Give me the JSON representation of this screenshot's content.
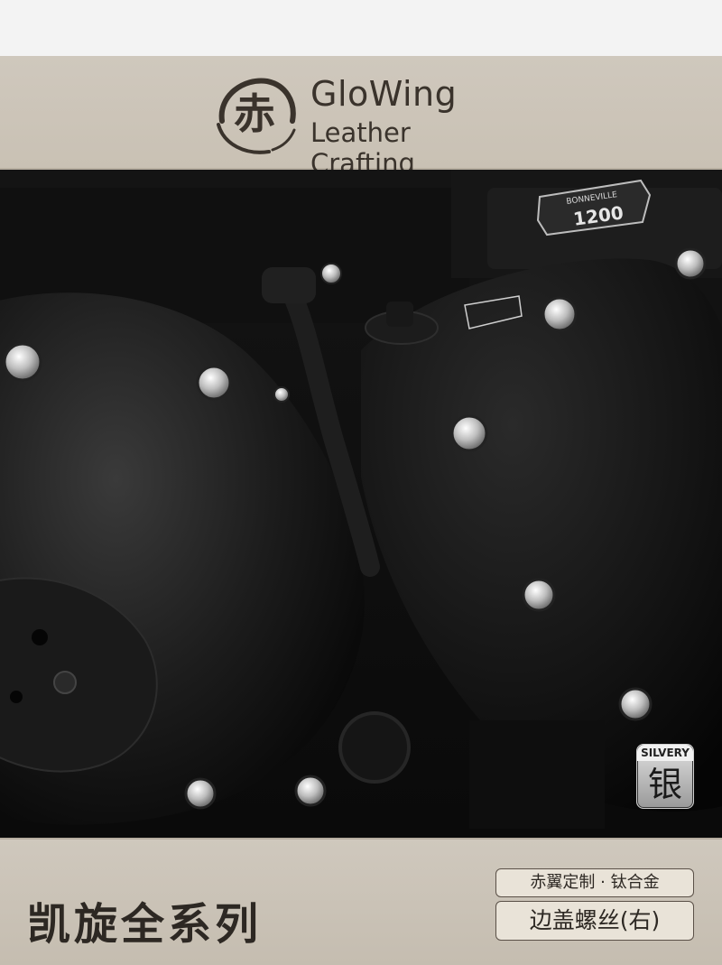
{
  "header": {
    "brand_name": "GloWing",
    "brand_sub": "Leather Crafting",
    "seal_char": "赤"
  },
  "photo": {
    "emblem_line1": "BONNEVILLE",
    "emblem_line2": "1200"
  },
  "tag": {
    "label": "SILVERY",
    "char": "银"
  },
  "footer": {
    "series_title": "凯旋全系列",
    "pill_top": "赤翼定制 · 钛合金",
    "pill_bottom": "边盖螺丝(右)"
  },
  "colors": {
    "band": "#cfc8bd",
    "text_dark": "#2d2823",
    "engine_black": "#0c0c0c"
  }
}
